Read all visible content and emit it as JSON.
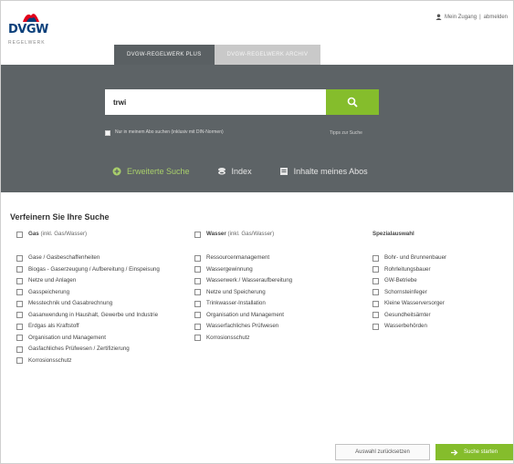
{
  "header": {
    "logo_text": "DVGW",
    "logo_sub": "REGELWERK",
    "user_label": "Mein Zugang",
    "separator": "|",
    "logout_label": "abmelden"
  },
  "tabs": [
    {
      "label": "DVGW-REGELWERK PLUS"
    },
    {
      "label": "DVGW-REGELWERK ARCHIV"
    }
  ],
  "search": {
    "value": "trwi",
    "checkbox_text": "Nur in meinem Abo suchen (inklusiv mit DIN-Normen)",
    "tips_link": "Tipps zur Suche"
  },
  "search_tabs": [
    {
      "label": "Erweiterte Suche",
      "icon": "plus-circle-icon"
    },
    {
      "label": "Index",
      "icon": "index-icon"
    },
    {
      "label": "Inhalte meines Abos",
      "icon": "document-icon"
    }
  ],
  "refine": {
    "title": "Verfeinern Sie Ihre Suche",
    "gas": {
      "head": "Gas",
      "head_sub": "(inkl. Gas/Wasser)",
      "items": [
        "Gase / Gasbeschaffenheiten",
        "Biogas - Gaserzeugung / Aufbereitung / Einspeisung",
        "Netze und Anlagen",
        "Gasspeicherung",
        "Messtechnik und Gasabrechnung",
        "Gasanwendung in Haushalt, Gewerbe und Industrie",
        "Erdgas als Kraftstoff",
        "Organisation und Management",
        "Gasfachliches Prüfwesen / Zertifizierung",
        "Korrosionsschutz"
      ]
    },
    "wasser": {
      "head": "Wasser",
      "head_sub": "(inkl. Gas/Wasser)",
      "items": [
        "Ressourcenmanagement",
        "Wassergewinnung",
        "Wasserwerk / Wasseraufbereitung",
        "Netze und Speicherung",
        "Trinkwasser-Installation",
        "Organisation und Management",
        "Wasserfachliches Prüfwesen",
        "Korrosionsschutz"
      ]
    },
    "spezial": {
      "head": "Spezialauswahl",
      "items": [
        "Bohr- und Brunnenbauer",
        "Rohrleitungsbauer",
        "GW-Betriebe",
        "Schornsteinfeger",
        "Kleine Wasserversorger",
        "Gesundheitsämter",
        "Wasserbehörden"
      ]
    }
  },
  "buttons": {
    "reset": "Auswahl zurücksetzen",
    "search": "Suche starten"
  },
  "colors": {
    "accent_green": "#85bd2c",
    "panel_dark": "#5d6366"
  }
}
